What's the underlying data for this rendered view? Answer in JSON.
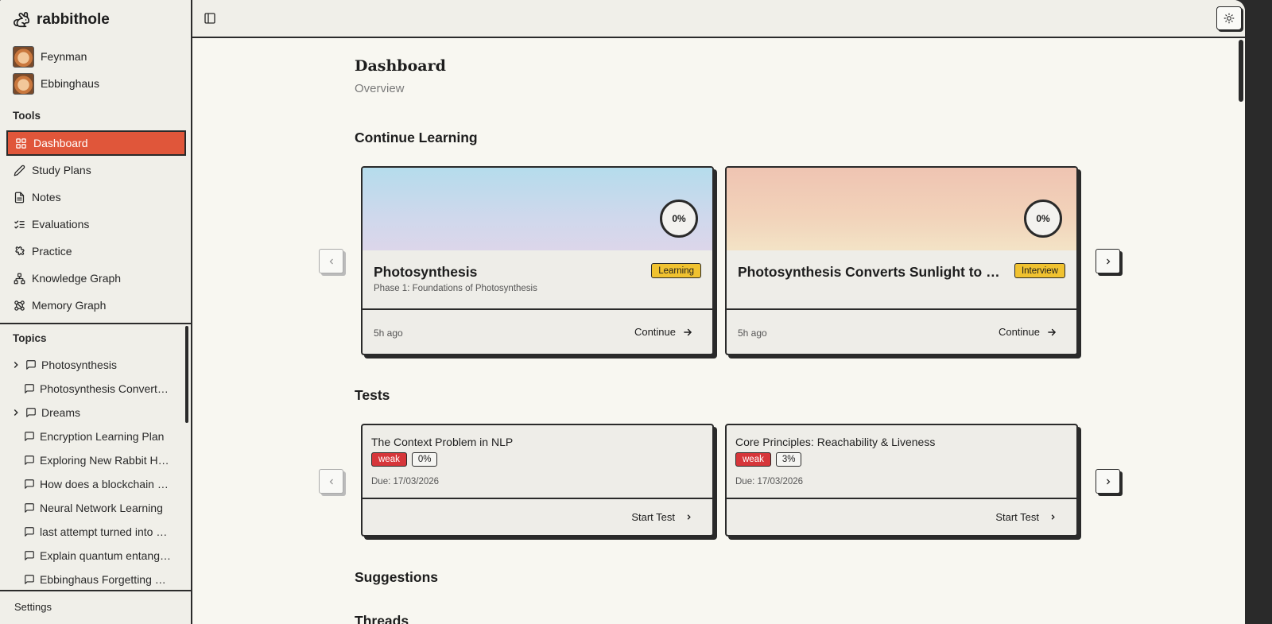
{
  "app": {
    "name": "rabbithole"
  },
  "sidebar": {
    "agents": [
      {
        "name": "Feynman"
      },
      {
        "name": "Ebbinghaus"
      }
    ],
    "tools_label": "Tools",
    "tools": [
      {
        "label": "Dashboard",
        "icon": "grid-icon",
        "active": true
      },
      {
        "label": "Study Plans",
        "icon": "pencil-icon"
      },
      {
        "label": "Notes",
        "icon": "document-icon"
      },
      {
        "label": "Evaluations",
        "icon": "checklist-icon"
      },
      {
        "label": "Practice",
        "icon": "puzzle-icon"
      },
      {
        "label": "Knowledge Graph",
        "icon": "hierarchy-icon"
      },
      {
        "label": "Memory Graph",
        "icon": "network-icon"
      }
    ],
    "topics_label": "Topics",
    "topics": [
      {
        "label": "Photosynthesis",
        "expandable": true
      },
      {
        "label": "Photosynthesis Converts Sunlight to Energy",
        "expandable": false
      },
      {
        "label": "Dreams",
        "expandable": true
      },
      {
        "label": "Encryption Learning Plan",
        "expandable": false
      },
      {
        "label": "Exploring New Rabbit Holes",
        "expandable": false
      },
      {
        "label": "How does a blockchain work",
        "expandable": false
      },
      {
        "label": "Neural Network Learning",
        "expandable": false
      },
      {
        "label": "last attempt turned into a plan",
        "expandable": false
      },
      {
        "label": "Explain quantum entanglement",
        "expandable": false
      },
      {
        "label": "Ebbinghaus Forgetting Curve",
        "expandable": false
      }
    ],
    "settings_label": "Settings"
  },
  "main": {
    "title": "Dashboard",
    "subtitle": "Overview",
    "continue_heading": "Continue Learning",
    "continue_cards": [
      {
        "title": "Photosynthesis",
        "badge": "Learning",
        "subtitle": "Phase 1: Foundations of Photosynthesis",
        "progress": "0%",
        "time": "5h ago",
        "action": "Continue",
        "banner": "blue"
      },
      {
        "title": "Photosynthesis Converts Sunlight to Energy",
        "badge": "Interview",
        "subtitle": "",
        "progress": "0%",
        "time": "5h ago",
        "action": "Continue",
        "banner": "peach"
      }
    ],
    "tests_heading": "Tests",
    "tests": [
      {
        "title": "The Context Problem in NLP",
        "strength": "weak",
        "score": "0%",
        "due": "Due: 17/03/2026",
        "action": "Start Test"
      },
      {
        "title": "Core Principles: Reachability & Liveness",
        "strength": "weak",
        "score": "3%",
        "due": "Due: 17/03/2026",
        "action": "Start Test"
      }
    ],
    "suggestions_heading": "Suggestions",
    "threads_heading": "Threads"
  },
  "colors": {
    "accent": "#e0563a",
    "badge": "#f0c230",
    "weak": "#d6363a",
    "background": "#f8f7f1",
    "ink": "#2a2a2a"
  }
}
